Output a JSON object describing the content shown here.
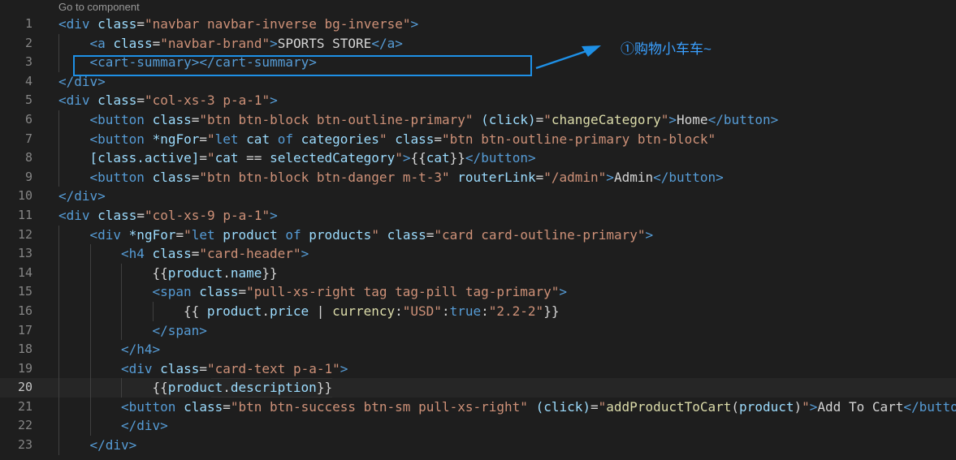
{
  "editor": {
    "codelens": "Go to component",
    "active_line": 20,
    "colors": {
      "background": "#1e1e1e",
      "tag": "#569cd6",
      "attribute": "#9cdcfe",
      "string": "#ce9178",
      "function": "#dcdcaa",
      "text": "#d4d4d4"
    },
    "lines": [
      {
        "no": "1",
        "indent": 0,
        "tokens": [
          [
            "tg",
            "<div "
          ],
          [
            "at",
            "class"
          ],
          [
            "tx",
            "="
          ],
          [
            "st",
            "\"navbar navbar-inverse bg-inverse\""
          ],
          [
            "tg",
            ">"
          ]
        ]
      },
      {
        "no": "2",
        "indent": 1,
        "tokens": [
          [
            "tg",
            "<a "
          ],
          [
            "at",
            "class"
          ],
          [
            "tx",
            "="
          ],
          [
            "st",
            "\"navbar-brand\""
          ],
          [
            "tg",
            ">"
          ],
          [
            "tx",
            "SPORTS STORE"
          ],
          [
            "tg",
            "</a>"
          ]
        ]
      },
      {
        "no": "3",
        "indent": 1,
        "tokens": [
          [
            "tg",
            "<cart-summary></cart-summary>"
          ]
        ]
      },
      {
        "no": "4",
        "indent": 0,
        "tokens": [
          [
            "tg",
            "</div>"
          ]
        ]
      },
      {
        "no": "5",
        "indent": 0,
        "tokens": [
          [
            "tg",
            "<div "
          ],
          [
            "at",
            "class"
          ],
          [
            "tx",
            "="
          ],
          [
            "st",
            "\"col-xs-3 p-a-1\""
          ],
          [
            "tg",
            ">"
          ]
        ]
      },
      {
        "no": "6",
        "indent": 1,
        "tokens": [
          [
            "tg",
            "<button "
          ],
          [
            "at",
            "class"
          ],
          [
            "tx",
            "="
          ],
          [
            "st",
            "\"btn btn-block btn-outline-primary\""
          ],
          [
            "tx",
            " "
          ],
          [
            "at",
            "(click)"
          ],
          [
            "tx",
            "="
          ],
          [
            "st",
            "\""
          ],
          [
            "fn",
            "changeCategory"
          ],
          [
            "st",
            "\""
          ],
          [
            "tg",
            ">"
          ],
          [
            "tx",
            "Home"
          ],
          [
            "tg",
            "</button>"
          ]
        ]
      },
      {
        "no": "7",
        "indent": 1,
        "tokens": [
          [
            "tg",
            "<button "
          ],
          [
            "at",
            "*ngFor"
          ],
          [
            "tx",
            "="
          ],
          [
            "st",
            "\""
          ],
          [
            "kw",
            "let "
          ],
          [
            "vr",
            "cat "
          ],
          [
            "kw",
            "of "
          ],
          [
            "vr",
            "categories"
          ],
          [
            "st",
            "\""
          ],
          [
            "tx",
            " "
          ],
          [
            "at",
            "class"
          ],
          [
            "tx",
            "="
          ],
          [
            "st",
            "\"btn btn-outline-primary btn-block\""
          ]
        ]
      },
      {
        "no": "8",
        "indent": 1,
        "tokens": [
          [
            "at",
            "[class.active]"
          ],
          [
            "tx",
            "="
          ],
          [
            "st",
            "\""
          ],
          [
            "vr",
            "cat "
          ],
          [
            "tx",
            "== "
          ],
          [
            "vr",
            "selectedCategory"
          ],
          [
            "st",
            "\""
          ],
          [
            "tg",
            ">"
          ],
          [
            "tx",
            "{{"
          ],
          [
            "vr",
            "cat"
          ],
          [
            "tx",
            "}}"
          ],
          [
            "tg",
            "</button>"
          ]
        ]
      },
      {
        "no": "9",
        "indent": 1,
        "tokens": [
          [
            "tg",
            "<button "
          ],
          [
            "at",
            "class"
          ],
          [
            "tx",
            "="
          ],
          [
            "st",
            "\"btn btn-block btn-danger m-t-3\""
          ],
          [
            "tx",
            " "
          ],
          [
            "at",
            "routerLink"
          ],
          [
            "tx",
            "="
          ],
          [
            "st",
            "\"/admin\""
          ],
          [
            "tg",
            ">"
          ],
          [
            "tx",
            "Admin"
          ],
          [
            "tg",
            "</button>"
          ]
        ]
      },
      {
        "no": "10",
        "indent": 0,
        "tokens": [
          [
            "tg",
            "</div>"
          ]
        ]
      },
      {
        "no": "11",
        "indent": 0,
        "tokens": [
          [
            "tg",
            "<div "
          ],
          [
            "at",
            "class"
          ],
          [
            "tx",
            "="
          ],
          [
            "st",
            "\"col-xs-9 p-a-1\""
          ],
          [
            "tg",
            ">"
          ]
        ]
      },
      {
        "no": "12",
        "indent": 1,
        "tokens": [
          [
            "tg",
            "<div "
          ],
          [
            "at",
            "*ngFor"
          ],
          [
            "tx",
            "="
          ],
          [
            "st",
            "\""
          ],
          [
            "kw",
            "let "
          ],
          [
            "vr",
            "product "
          ],
          [
            "kw",
            "of "
          ],
          [
            "vr",
            "products"
          ],
          [
            "st",
            "\""
          ],
          [
            "tx",
            " "
          ],
          [
            "at",
            "class"
          ],
          [
            "tx",
            "="
          ],
          [
            "st",
            "\"card card-outline-primary\""
          ],
          [
            "tg",
            ">"
          ]
        ]
      },
      {
        "no": "13",
        "indent": 2,
        "tokens": [
          [
            "tg",
            "<h4 "
          ],
          [
            "at",
            "class"
          ],
          [
            "tx",
            "="
          ],
          [
            "st",
            "\"card-header\""
          ],
          [
            "tg",
            ">"
          ]
        ]
      },
      {
        "no": "14",
        "indent": 3,
        "tokens": [
          [
            "tx",
            "{{"
          ],
          [
            "vr",
            "product"
          ],
          [
            "tx",
            "."
          ],
          [
            "vr",
            "name"
          ],
          [
            "tx",
            "}}"
          ]
        ]
      },
      {
        "no": "15",
        "indent": 3,
        "tokens": [
          [
            "tg",
            "<span "
          ],
          [
            "at",
            "class"
          ],
          [
            "tx",
            "="
          ],
          [
            "st",
            "\"pull-xs-right tag tag-pill tag-primary\""
          ],
          [
            "tg",
            ">"
          ]
        ]
      },
      {
        "no": "16",
        "indent": 4,
        "tokens": [
          [
            "tx",
            "{{ "
          ],
          [
            "vr",
            "product"
          ],
          [
            "tx",
            "."
          ],
          [
            "vr",
            "price"
          ],
          [
            "tx",
            " | "
          ],
          [
            "fn",
            "currency"
          ],
          [
            "tx",
            ":"
          ],
          [
            "st",
            "\"USD\""
          ],
          [
            "tx",
            ":"
          ],
          [
            "kw",
            "true"
          ],
          [
            "tx",
            ":"
          ],
          [
            "st",
            "\"2.2-2\""
          ],
          [
            "tx",
            "}}"
          ]
        ]
      },
      {
        "no": "17",
        "indent": 3,
        "tokens": [
          [
            "tg",
            "</span>"
          ]
        ]
      },
      {
        "no": "18",
        "indent": 2,
        "tokens": [
          [
            "tg",
            "</h4>"
          ]
        ]
      },
      {
        "no": "19",
        "indent": 2,
        "tokens": [
          [
            "tg",
            "<div "
          ],
          [
            "at",
            "class"
          ],
          [
            "tx",
            "="
          ],
          [
            "st",
            "\"card-text p-a-1\""
          ],
          [
            "tg",
            ">"
          ]
        ]
      },
      {
        "no": "20",
        "indent": 3,
        "tokens": [
          [
            "tx",
            "{{"
          ],
          [
            "vr",
            "product"
          ],
          [
            "tx",
            "."
          ],
          [
            "vr",
            "description"
          ],
          [
            "tx",
            "}}"
          ]
        ]
      },
      {
        "no": "21",
        "indent": 2,
        "tokens": [
          [
            "tg",
            "<button "
          ],
          [
            "at",
            "class"
          ],
          [
            "tx",
            "="
          ],
          [
            "st",
            "\"btn btn-success btn-sm pull-xs-right\""
          ],
          [
            "tx",
            " "
          ],
          [
            "at",
            "(click)"
          ],
          [
            "tx",
            "="
          ],
          [
            "st",
            "\""
          ],
          [
            "fn",
            "addProductToCart"
          ],
          [
            "tx",
            "("
          ],
          [
            "vr",
            "product"
          ],
          [
            "tx",
            ")"
          ],
          [
            "st",
            "\""
          ],
          [
            "tg",
            ">"
          ],
          [
            "tx",
            "Add To Cart"
          ],
          [
            "tg",
            "</button>"
          ]
        ]
      },
      {
        "no": "22",
        "indent": 2,
        "tokens": [
          [
            "tg",
            "</div>"
          ]
        ]
      },
      {
        "no": "23",
        "indent": 1,
        "tokens": [
          [
            "tg",
            "</div>"
          ]
        ]
      }
    ]
  },
  "annotation": {
    "text": "①购物小车车~",
    "color": "#3aa0ff"
  }
}
